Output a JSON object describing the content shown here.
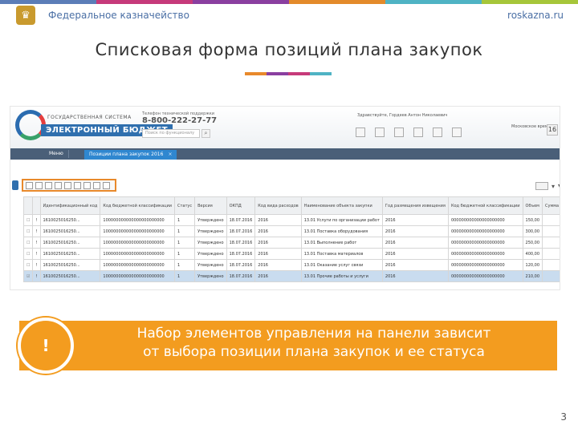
{
  "header": {
    "org_name": "Федеральное казначейство",
    "site": "roskazna.ru",
    "stripe_colors": [
      "#5b7db8",
      "#c63a7a",
      "#8a3fa0",
      "#e38a2b",
      "#4fb3c4",
      "#a6c63a"
    ]
  },
  "slide": {
    "title": "Списковая форма позиций плана закупок",
    "underline_colors": [
      "#e8892b",
      "#8a3fa0",
      "#c63a7a",
      "#4fb3c4"
    ],
    "page_number": "3"
  },
  "app": {
    "logo_small": "ГОСУДАРСТВЕННАЯ СИСТЕМА",
    "logo_text": "ЭЛЕКТРОННЫЙ БЮДЖЕТ",
    "support_label": "Телефон технической поддержки",
    "phone": "8-800-222-27-77",
    "search_placeholder": "Поиск по функционалу",
    "greeting": "Здравствуйте, Гордеев Антон Николаевич",
    "date_label": "Московское время",
    "day": "16",
    "nav_home": "Меню",
    "nav_tab": "Позиции плана закупок 2016",
    "nav_tab_close": "×",
    "settings_icon": "▾",
    "filter_icon": "▼"
  },
  "grid": {
    "columns": [
      "",
      "",
      "Идентификационный код",
      "Код бюджетной классификации",
      "Статус",
      "Версия",
      "ОКПД",
      "Код вида расходов",
      "Наименование объекта закупки",
      "Год размещения извещения",
      "Код бюджетной классификации",
      "Объем",
      "Сумма"
    ],
    "rows": [
      [
        "☐",
        "!",
        "1610025016250...",
        "100000000000000000000000",
        "1",
        "Утверждено",
        "18.07.2016",
        "2016",
        "13.01 Услуги по организации работ",
        "2016",
        "000000000000000000000",
        "150,00",
        ""
      ],
      [
        "☐",
        "!",
        "1610025016250...",
        "100000000000000000000000",
        "1",
        "Утверждено",
        "18.07.2016",
        "2016",
        "13.01 Поставка оборудования",
        "2016",
        "000000000000000000000",
        "300,00",
        ""
      ],
      [
        "☐",
        "!",
        "1610025016250...",
        "100000000000000000000000",
        "1",
        "Утверждено",
        "18.07.2016",
        "2016",
        "13.01 Выполнение работ",
        "2016",
        "000000000000000000000",
        "250,00",
        ""
      ],
      [
        "☐",
        "!",
        "1610025016250...",
        "100000000000000000000000",
        "1",
        "Утверждено",
        "18.07.2016",
        "2016",
        "13.01 Поставка материалов",
        "2016",
        "000000000000000000000",
        "400,00",
        ""
      ],
      [
        "☐",
        "!",
        "1610025016250...",
        "100000000000000000000000",
        "1",
        "Утверждено",
        "18.07.2016",
        "2016",
        "13.01 Оказание услуг связи",
        "2016",
        "000000000000000000000",
        "120,00",
        ""
      ],
      [
        "☑",
        "!",
        "1610025016250...",
        "100000000000000000000000",
        "1",
        "Утверждено",
        "18.07.2016",
        "2016",
        "13.01 Прочие работы и услуги",
        "2016",
        "000000000000000000000",
        "210,00",
        ""
      ]
    ]
  },
  "callout": {
    "badge": "!",
    "text_line1": "Набор элементов управления на панели зависит",
    "text_line2": "от выбора позиции плана закупок и ее статуса"
  }
}
